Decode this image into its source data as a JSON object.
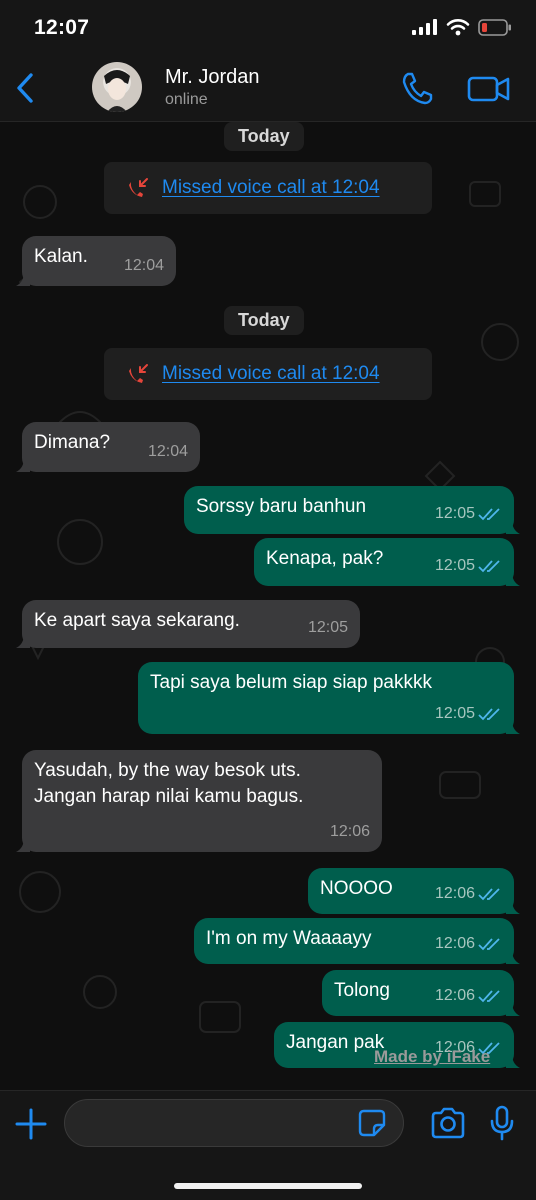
{
  "status_bar": {
    "time": "12:07"
  },
  "header": {
    "contact_name": "Mr. Jordan",
    "contact_status": "online"
  },
  "colors": {
    "accent": "#1f8af0",
    "outgoing": "#005e4d",
    "incoming": "#3a3a3c",
    "missed": "#e5453a",
    "ticks": "#4fb6ec"
  },
  "chat": {
    "date_1": "Today",
    "missed_1": "Missed voice call at 12:04",
    "date_2": "Today",
    "missed_2": "Missed voice call at 12:04",
    "messages": [
      {
        "text": "Kalan.",
        "time": "12:04"
      },
      {
        "text": "Dimana?",
        "time": "12:04"
      },
      {
        "text": "Sorssy baru banhun",
        "time": "12:05"
      },
      {
        "text": "Kenapa, pak?",
        "time": "12:05"
      },
      {
        "text": "Ke apart saya sekarang.",
        "time": "12:05"
      },
      {
        "text": "Tapi saya belum siap siap pakkkk",
        "time": "12:05"
      },
      {
        "text": "Yasudah, by the way besok uts.",
        "text2": "Jangan harap nilai kamu bagus.",
        "time": "12:06"
      },
      {
        "text": "NOOOO",
        "time": "12:06"
      },
      {
        "text": "I'm on my Waaaayy",
        "time": "12:06"
      },
      {
        "text": "Tolong",
        "time": "12:06"
      },
      {
        "text": "Jangan pak",
        "time": "12:06"
      }
    ],
    "watermark": "Made by iFake"
  },
  "input_bar": {
    "placeholder": ""
  }
}
